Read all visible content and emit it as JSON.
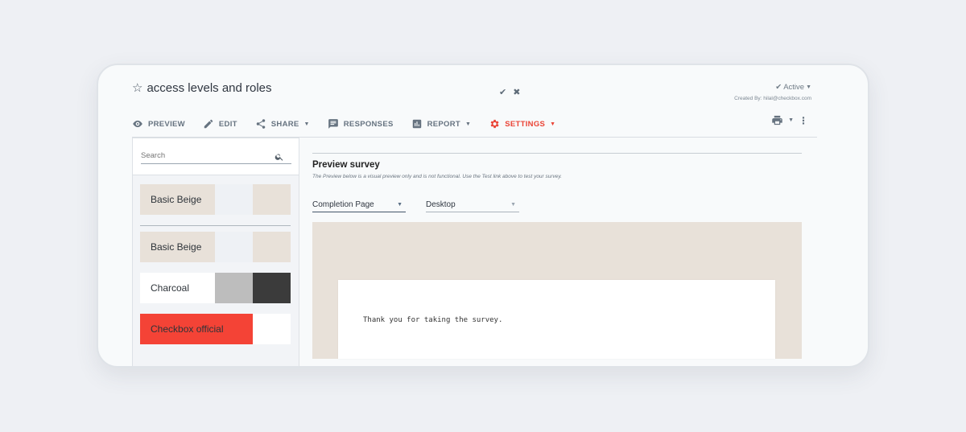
{
  "survey": {
    "title": "access levels and roles",
    "status": "Active",
    "created_by": "Created By: hilal@checkbox.com"
  },
  "nav": {
    "items": [
      {
        "label": "PREVIEW",
        "icon": "eye-icon"
      },
      {
        "label": "EDIT",
        "icon": "pencil-icon"
      },
      {
        "label": "SHARE",
        "icon": "share-icon"
      },
      {
        "label": "RESPONSES",
        "icon": "comment-icon"
      },
      {
        "label": "REPORT",
        "icon": "bar-chart-icon"
      },
      {
        "label": "SETTINGS",
        "icon": "gear-icon"
      }
    ],
    "active": "SETTINGS"
  },
  "sidebar": {
    "search_placeholder": "Search",
    "themes": [
      {
        "label": "Basic Beige",
        "colors": [
          "#e8e1d9",
          "#eef1f5",
          "#e8e1d9"
        ]
      },
      {
        "label": "Basic Beige",
        "colors": [
          "#e8e1d9",
          "#eef1f5",
          "#e8e1d9"
        ]
      },
      {
        "label": "Charcoal",
        "colors": [
          "#ffffff",
          "#bdbdbd",
          "#3b3b3b"
        ]
      },
      {
        "label": "Checkbox official",
        "colors": [
          "#f44336",
          "#f44336",
          "#ffffff"
        ]
      }
    ]
  },
  "preview": {
    "title": "Preview survey",
    "subtitle": "The Preview below is a visual preview only and is not functional. Use the Test link above to test your survey.",
    "page_select": "Completion Page",
    "device_select": "Desktop",
    "completion_text": "Thank you for taking the survey."
  },
  "colors": {
    "accent": "#ea4335",
    "canvas_bg": "#e8e1d9"
  }
}
